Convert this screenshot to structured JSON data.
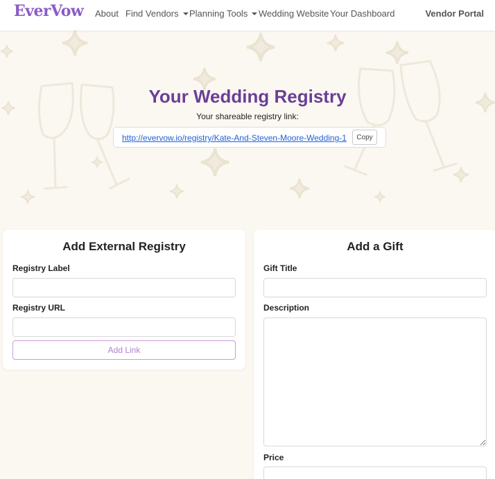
{
  "nav": {
    "brand": "EverVow",
    "links": [
      {
        "label": "About"
      },
      {
        "label": "Find Vendors"
      },
      {
        "label": "Planning Tools"
      },
      {
        "label": "Wedding Website"
      },
      {
        "label": "Your Dashboard"
      }
    ],
    "vendor_portal": "Vendor Portal"
  },
  "hero": {
    "title": "Your Wedding Registry",
    "subtitle": "Your shareable registry link:",
    "link": "http://evervow.io/registry/Kate-And-Steven-Moore-Wedding-1",
    "copy_label": "Copy"
  },
  "external_registry": {
    "title": "Add External Registry",
    "label_field": {
      "label": "Registry Label",
      "value": "",
      "placeholder": ""
    },
    "url_field": {
      "label": "Registry URL",
      "value": "",
      "placeholder": ""
    },
    "button": "Add Link"
  },
  "gift": {
    "title": "Add a Gift",
    "title_field": {
      "label": "Gift Title",
      "value": "",
      "placeholder": ""
    },
    "description_field": {
      "label": "Description",
      "value": "",
      "placeholder": ""
    },
    "price_field": {
      "label": "Price",
      "value": "",
      "placeholder": ""
    }
  },
  "colors": {
    "brand": "#8b5cc7",
    "title": "#6a3f96",
    "link": "#1f5fd6",
    "background": "#fbf8f2",
    "button_border": "#c79be0"
  }
}
